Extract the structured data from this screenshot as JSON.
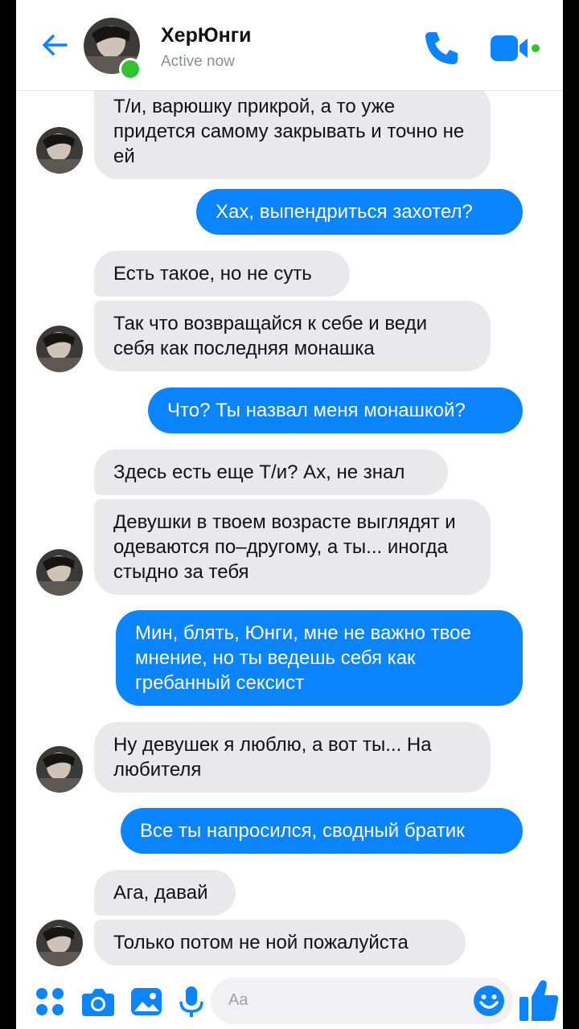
{
  "header": {
    "contact_name": "ХерЮнги",
    "status": "Active now"
  },
  "colors": {
    "accent": "#0b84ff",
    "incoming_bubble": "#e9e9eb",
    "online": "#31c431"
  },
  "icons": [
    "back-arrow-icon",
    "phone-icon",
    "video-camera-icon",
    "apps-grid-icon",
    "camera-icon",
    "gallery-icon",
    "microphone-icon",
    "emoji-icon",
    "thumbs-up-icon"
  ],
  "messages": [
    {
      "from": "contact",
      "text": "Т/и, варюшку прикрой, а то уже придется самому закрывать и точно не ей"
    },
    {
      "from": "me",
      "text": "Хах, выпендриться захотел?"
    },
    {
      "from": "contact",
      "text": "Есть такое, но не суть"
    },
    {
      "from": "contact",
      "text": "Так что возвращайся к себе и веди себя как последняя монашка"
    },
    {
      "from": "me",
      "text": "Что? Ты назвал меня монашкой?"
    },
    {
      "from": "contact",
      "text": "Здесь есть еще Т/и? Ах, не знал"
    },
    {
      "from": "contact",
      "text": "Девушки в твоем возрасте выглядят и одеваются по–другому, а ты... иногда стыдно за тебя"
    },
    {
      "from": "me",
      "text": "Мин, блять, Юнги, мне не важно твое мнение, но ты ведешь себя как гребанный сексист"
    },
    {
      "from": "contact",
      "text": "Ну девушек я люблю, а вот ты... На любителя"
    },
    {
      "from": "me",
      "text": "Все ты напросился, сводный братик"
    },
    {
      "from": "contact",
      "text": "Ага, давай"
    },
    {
      "from": "contact",
      "text": "Только потом не ной пожалуйста"
    }
  ],
  "composer": {
    "placeholder": "Aa"
  }
}
